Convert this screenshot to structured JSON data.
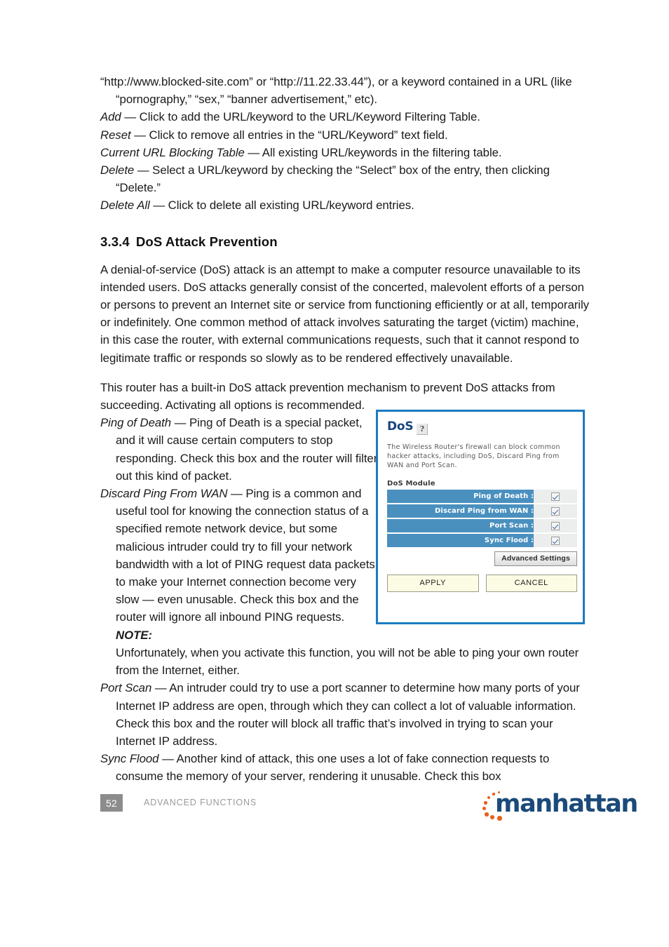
{
  "document": {
    "page_number": "52",
    "footer_label": "ADVANCED FUNCTIONS",
    "brand": "manhattan"
  },
  "intro": {
    "line1": "“http://www.blocked-site.com” or “http://11.22.33.44”), or a keyword contained in a URL (like “pornography,” “sex,” “banner advertisement,” etc).",
    "items": [
      {
        "term": "Add",
        "text": " — Click to add the URL/keyword to the URL/Keyword Filtering Table."
      },
      {
        "term": "Reset",
        "text": " — Click to remove all entries in the “URL/Keyword” text field."
      },
      {
        "term": "Current URL Blocking Table",
        "text": " — All existing URL/keywords in the filtering table."
      },
      {
        "term": "Delete",
        "text": " — Select a URL/keyword by checking the “Select” box of the entry, then clicking “Delete.”"
      },
      {
        "term": "Delete All",
        "text": " — Click to delete all existing URL/keyword entries."
      }
    ]
  },
  "section": {
    "number": "3.3.4",
    "title": "DoS Attack Prevention",
    "paragraph1": "A denial-of-service (DoS) attack is an attempt to make a computer resource unavailable to its intended users. DoS attacks generally consist of the concerted, malevolent efforts of a person or persons to prevent an Internet site or service from functioning efficiently or at all, temporarily or indefinitely. One common method of attack involves saturating the target (victim) machine, in this case the router, with external communications requests, such that it cannot respond to legitimate traffic or responds so slowly as to be rendered effectively unavailable.",
    "paragraph2": "This router has a built-in DoS attack prevention mechanism to prevent DoS attacks from succeeding. Activating all options is recommended."
  },
  "definitions": {
    "ping_of_death": {
      "term": "Ping of Death",
      "text": " — Ping of Death is a special packet, and it will cause certain computers to stop responding. Check this box and the router will filter out this kind of packet."
    },
    "discard_ping": {
      "term": "Discard Ping From WAN",
      "text": " — Ping is a common and useful tool for knowing the connection status of a specified remote network device, but some malicious intruder could try to fill your network bandwidth with a lot of PING request data packets to make your Internet connection become very slow — even unusable. Check this box and the router will ignore all inbound PING requests. ",
      "note": "NOTE:",
      "note_text": " Unfortunately, when you activate this function, you will not be able to ping your own router from the Internet, either."
    },
    "port_scan": {
      "term": "Port Scan",
      "text": " — An intruder could try to use a port scanner to determine how many ports of your Internet IP address are open, through which they can collect a lot of valuable information. Check this box and the router will block all traffic that’s involved in trying to scan your Internet IP address."
    },
    "sync_flood": {
      "term": "Sync Flood",
      "text": " — Another kind of attack, this one uses a lot of fake connection requests to consume the memory of your server, rendering it unusable. Check this box"
    }
  },
  "router_ui": {
    "title": "DoS",
    "help_icon": "?",
    "description": "The Wireless Router's firewall can block common hacker attacks, including DoS, Discard Ping from WAN and Port Scan.",
    "module_label": "DoS Module",
    "rows": [
      {
        "label": "Ping of Death :",
        "checked": true
      },
      {
        "label": "Discard Ping from WAN :",
        "checked": true
      },
      {
        "label": "Port Scan :",
        "checked": true
      },
      {
        "label": "Sync Flood :",
        "checked": true
      }
    ],
    "advanced_button": "Advanced Settings",
    "apply_button": "APPLY",
    "cancel_button": "CANCEL",
    "colors": {
      "border": "#1b7bc4",
      "row": "#4a90bf",
      "title": "#17457f",
      "button_cream": "#fcfbe3"
    }
  }
}
